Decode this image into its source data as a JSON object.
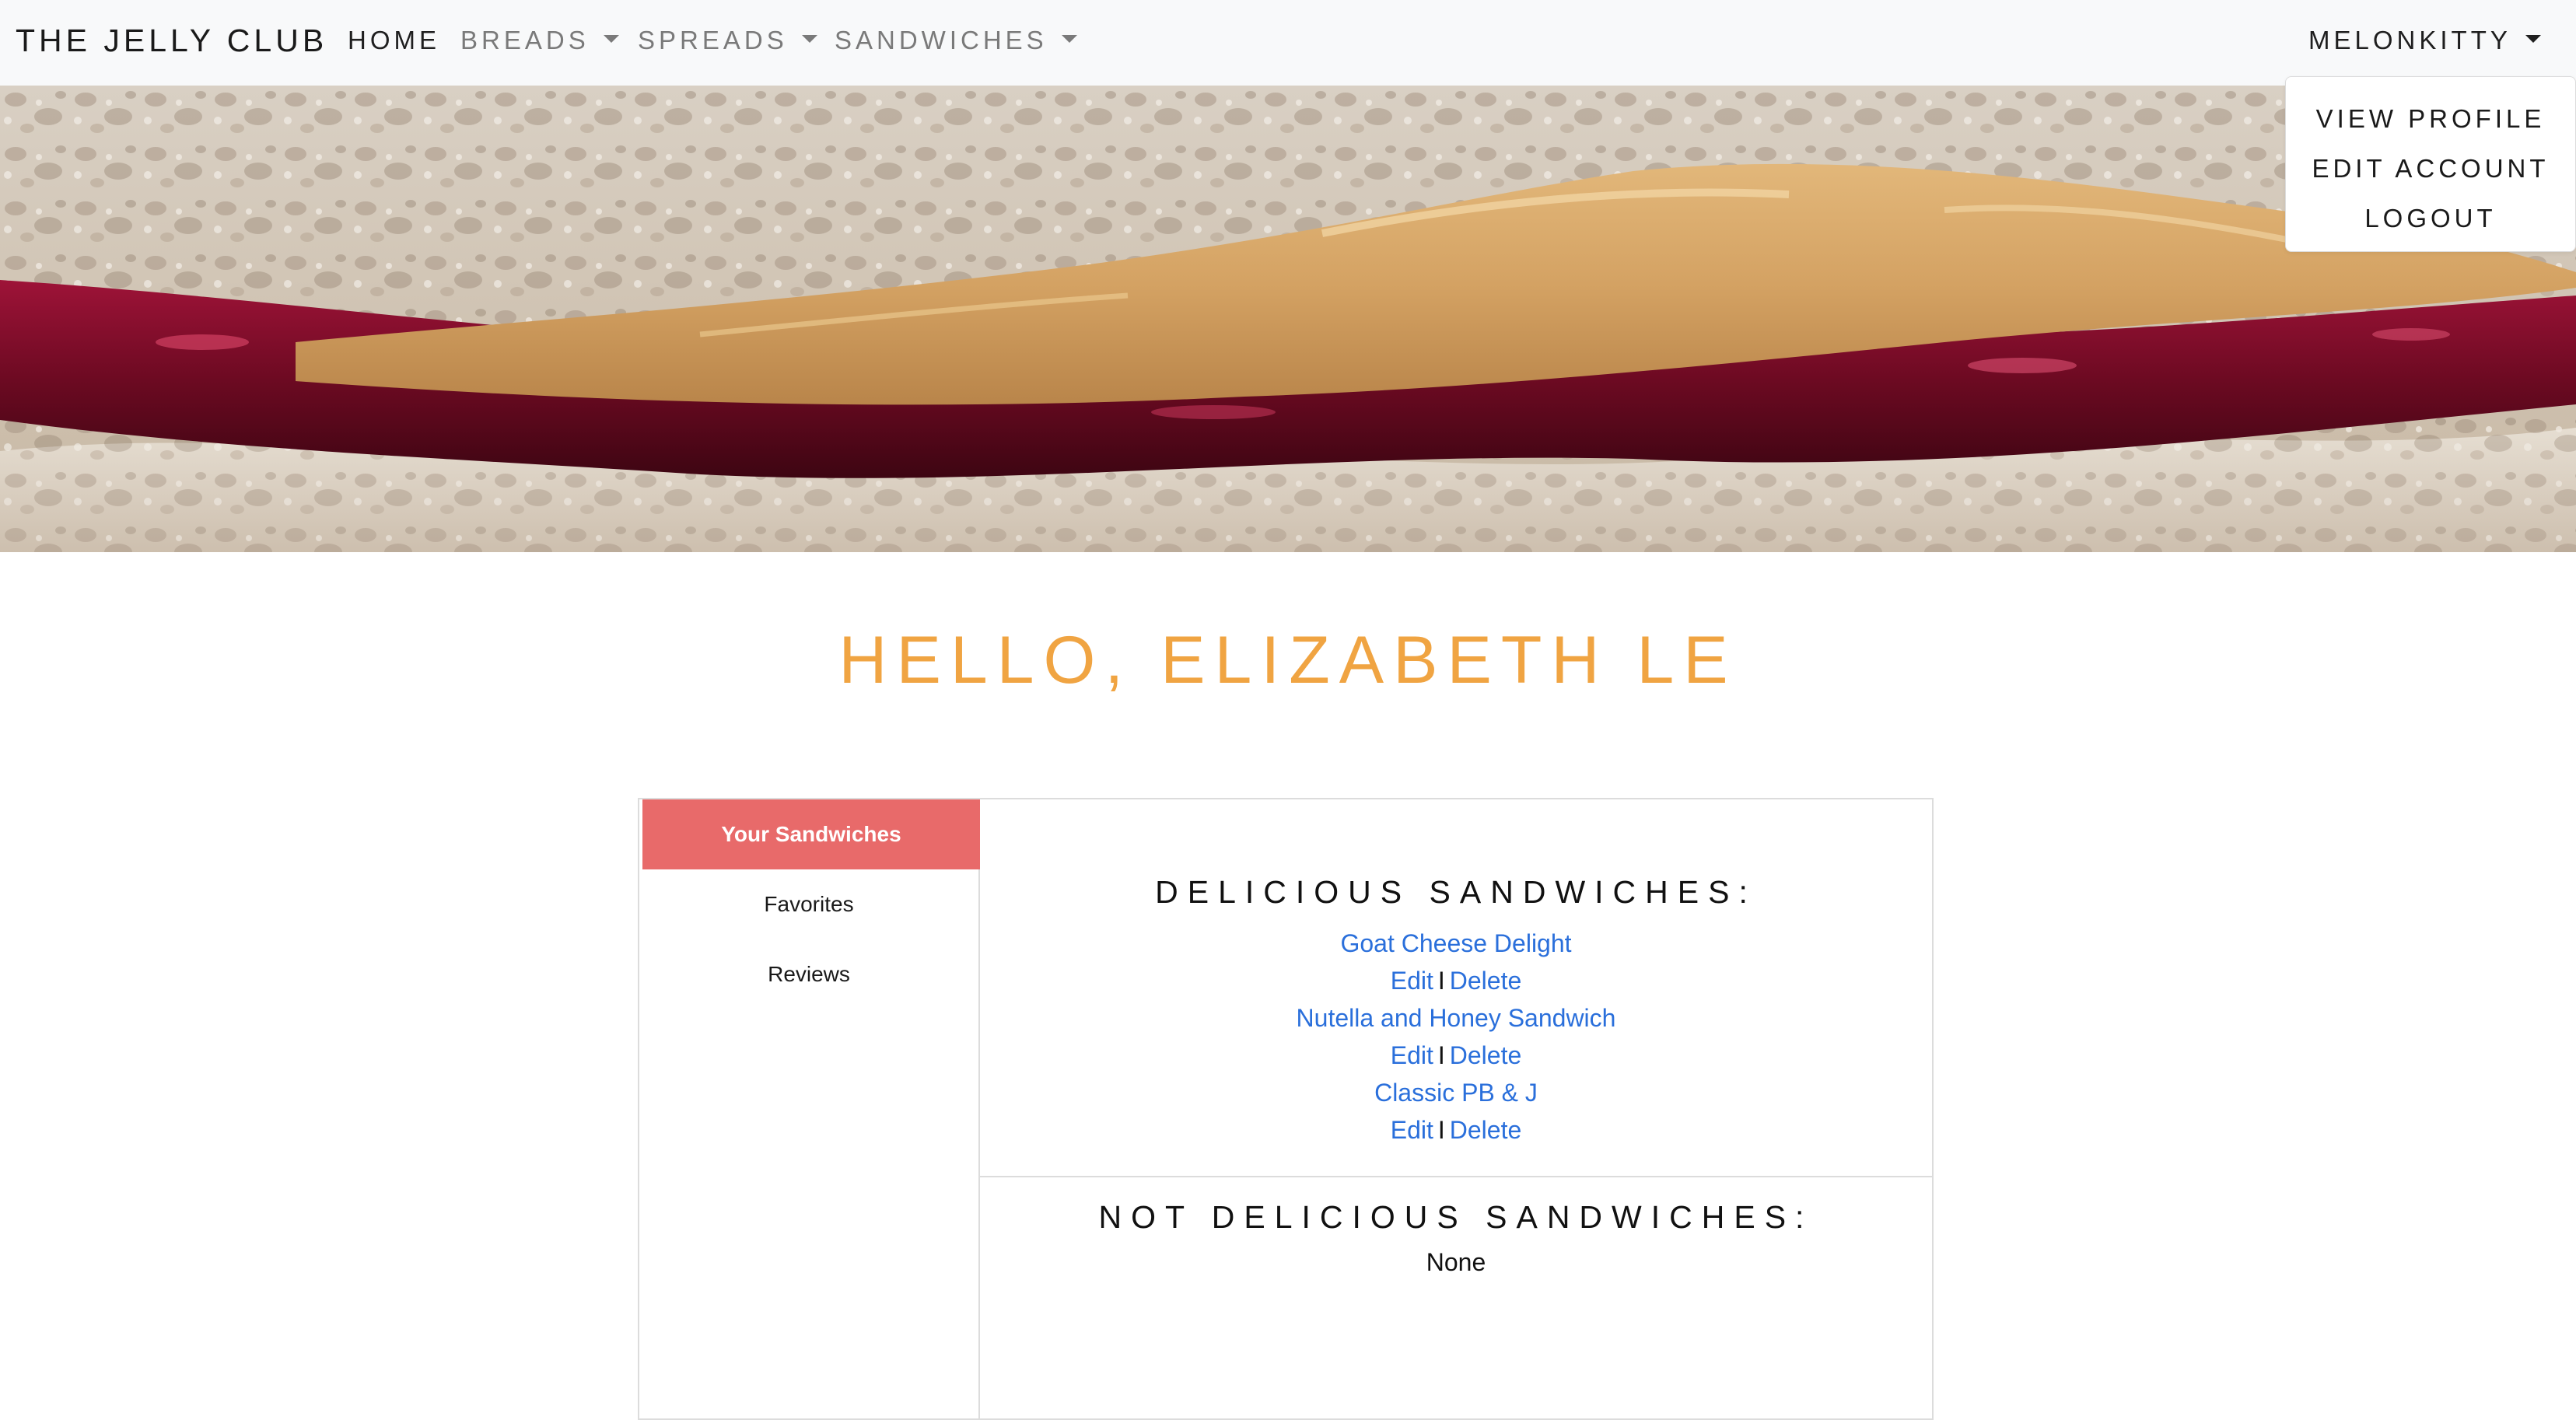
{
  "navbar": {
    "brand": "THE JELLY CLUB",
    "home": "HOME",
    "breads": "BREADS",
    "spreads": "SPREADS",
    "sandwiches": "SANDWICHES",
    "user": "MELONKITTY"
  },
  "user_menu": {
    "items": [
      "VIEW PROFILE",
      "EDIT ACCOUNT",
      "LOGOUT"
    ]
  },
  "greeting": "HELLO, ELIZABETH LE",
  "tabs": [
    "Your Sandwiches",
    "Favorites",
    "Reviews"
  ],
  "delicious": {
    "title": "DELICIOUS SANDWICHES:",
    "sandwiches": [
      "Goat Cheese Delight",
      "Nutella and Honey Sandwich",
      "Classic PB & J"
    ],
    "edit_label": "Edit",
    "separator": "I",
    "delete_label": "Delete"
  },
  "not_delicious": {
    "title": "NOT DELICIOUS SANDWICHES:",
    "empty_text": "None"
  },
  "colors": {
    "accent": "#f0a442",
    "active_tab": "#e86a6a",
    "link": "#2a6fdb"
  }
}
